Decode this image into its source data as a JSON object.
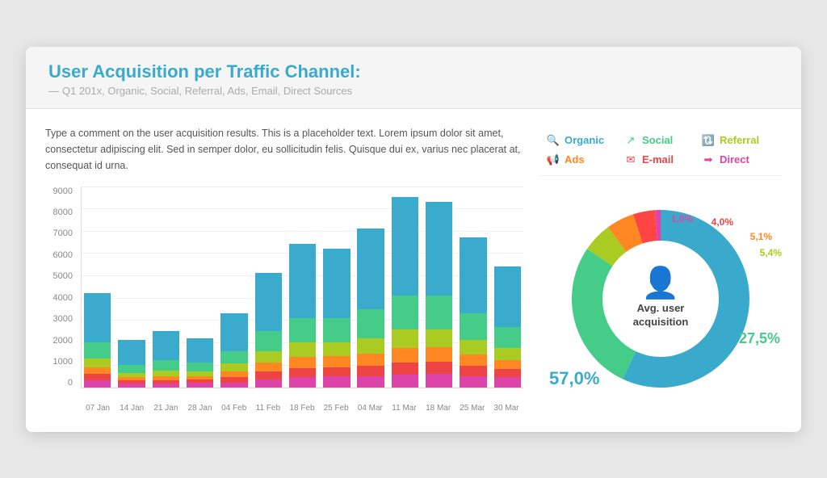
{
  "header": {
    "title": "User Acquisition per Traffic Channel:",
    "subtitle": "Q1 201x, Organic, Social, Referral, Ads, Email, Direct Sources"
  },
  "comment": "Type a comment on the user acquisition results. This is a placeholder text. Lorem ipsum dolor sit amet, consectetur adipiscing elit. Sed in semper dolor, eu sollicitudin felis. Quisque dui ex, varius nec placerat at, consequat id urna.",
  "legend": [
    {
      "id": "organic",
      "label": "Organic",
      "color": "#3aaacc",
      "icon": "🔍"
    },
    {
      "id": "social",
      "label": "Social",
      "color": "#44cc88",
      "icon": "↗"
    },
    {
      "id": "referral",
      "label": "Referral",
      "color": "#aacc22",
      "icon": "🔃"
    },
    {
      "id": "ads",
      "label": "Ads",
      "color": "#ff8822",
      "icon": "📢"
    },
    {
      "id": "email",
      "label": "E-mail",
      "color": "#ee4444",
      "icon": "✉"
    },
    {
      "id": "direct",
      "label": "Direct",
      "color": "#dd44aa",
      "icon": "➡"
    }
  ],
  "yAxis": [
    "9000",
    "8000",
    "7000",
    "6000",
    "5000",
    "4000",
    "3000",
    "2000",
    "1000",
    "0"
  ],
  "xAxis": [
    "07 Jan",
    "14 Jan",
    "21 Jan",
    "28 Jan",
    "04 Feb",
    "11 Feb",
    "18 Feb",
    "25 Feb",
    "04 Mar",
    "11 Mar",
    "18 Mar",
    "25 Mar",
    "30 Mar"
  ],
  "bars": [
    {
      "total": 4200,
      "organic": 2200,
      "social": 700,
      "referral": 400,
      "ads": 300,
      "email": 300,
      "direct": 300
    },
    {
      "total": 2100,
      "organic": 1100,
      "social": 350,
      "referral": 200,
      "ads": 150,
      "email": 150,
      "direct": 150
    },
    {
      "total": 2500,
      "organic": 1300,
      "social": 450,
      "referral": 250,
      "ads": 200,
      "email": 150,
      "direct": 150
    },
    {
      "total": 2200,
      "organic": 1100,
      "social": 400,
      "referral": 200,
      "ads": 150,
      "email": 150,
      "direct": 200
    },
    {
      "total": 3300,
      "organic": 1700,
      "social": 550,
      "referral": 350,
      "ads": 250,
      "email": 250,
      "direct": 200
    },
    {
      "total": 5100,
      "organic": 2600,
      "social": 900,
      "referral": 500,
      "ads": 400,
      "email": 350,
      "direct": 350
    },
    {
      "total": 6400,
      "organic": 3300,
      "social": 1100,
      "referral": 650,
      "ads": 500,
      "email": 400,
      "direct": 450
    },
    {
      "total": 6200,
      "organic": 3100,
      "social": 1100,
      "referral": 600,
      "ads": 500,
      "email": 400,
      "direct": 500
    },
    {
      "total": 7100,
      "organic": 3600,
      "social": 1300,
      "referral": 700,
      "ads": 550,
      "email": 450,
      "direct": 500
    },
    {
      "total": 8500,
      "organic": 4400,
      "social": 1500,
      "referral": 850,
      "ads": 650,
      "email": 550,
      "direct": 550
    },
    {
      "total": 8300,
      "organic": 4200,
      "social": 1500,
      "referral": 800,
      "ads": 650,
      "email": 550,
      "direct": 600
    },
    {
      "total": 6700,
      "organic": 3400,
      "social": 1200,
      "referral": 650,
      "ads": 500,
      "email": 450,
      "direct": 500
    },
    {
      "total": 5400,
      "organic": 2700,
      "social": 950,
      "referral": 550,
      "ads": 400,
      "email": 350,
      "direct": 450
    }
  ],
  "donut": {
    "segments": [
      {
        "id": "organic",
        "value": 57.0,
        "color": "#3aaacc",
        "label": "57,0%",
        "position": "left"
      },
      {
        "id": "social",
        "value": 27.5,
        "color": "#44cc88",
        "label": "27,5%",
        "position": "right"
      },
      {
        "id": "referral",
        "value": 5.4,
        "color": "#aacc22",
        "label": "5,4%",
        "position": "top-right-far"
      },
      {
        "id": "ads",
        "value": 5.1,
        "color": "#ff8822",
        "label": "5,1%",
        "position": "top-right-mid"
      },
      {
        "id": "email",
        "value": 4.0,
        "color": "#ff4444",
        "label": "4,0%",
        "position": "top-mid"
      },
      {
        "id": "direct",
        "value": 1.0,
        "color": "#dd44aa",
        "label": "1,0%",
        "position": "top-left"
      }
    ],
    "center_text": "Avg. user\nacquisition"
  }
}
